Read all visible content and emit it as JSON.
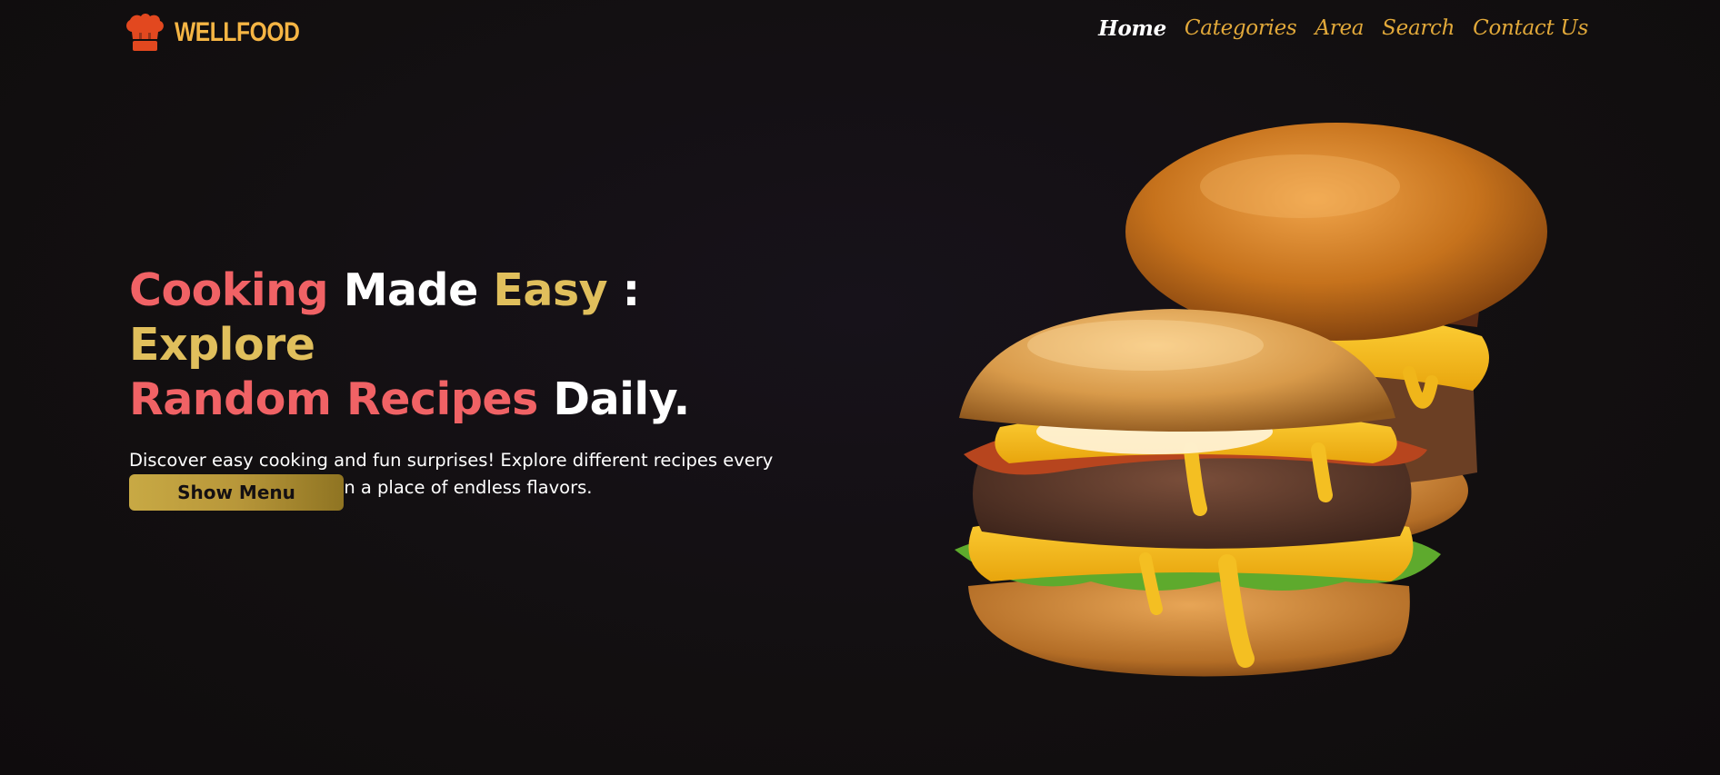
{
  "brand": {
    "name": "WELLFOOD",
    "icon": "chef-hat-icon",
    "color": "#f5b544",
    "icon_color": "#e2481f"
  },
  "nav": {
    "items": [
      {
        "label": "Home",
        "active": true
      },
      {
        "label": "Categories",
        "active": false
      },
      {
        "label": "Area",
        "active": false
      },
      {
        "label": "Search",
        "active": false
      },
      {
        "label": "Contact Us",
        "active": false
      }
    ]
  },
  "hero": {
    "title_words": {
      "w1": "Cooking",
      "w2": "Made",
      "w3": "Easy",
      "w4": ":",
      "w5": "Explore",
      "w6": "Random Recipes",
      "w7": "Daily."
    },
    "subtitle": "Discover easy cooking and fun surprises! Explore different recipes every day, making your kitchen a place of endless flavors.",
    "button_label": "Show Menu"
  },
  "colors": {
    "background": "#141012",
    "accent_red": "#f06265",
    "accent_gold": "#e0bf5c",
    "nav_gold": "#e2a93a"
  },
  "image": {
    "name": "double-burger-image"
  }
}
